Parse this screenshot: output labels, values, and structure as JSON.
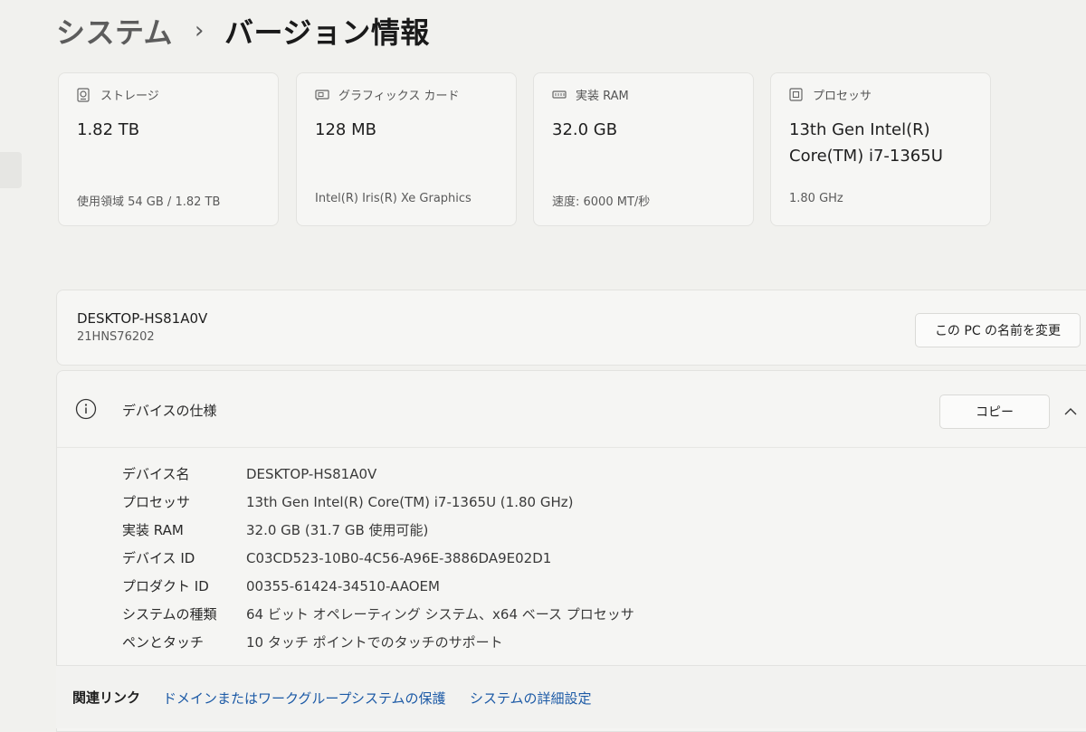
{
  "breadcrumb": {
    "parent": "システム",
    "separator": "›",
    "current": "バージョン情報"
  },
  "cards": [
    {
      "icon": "storage-icon",
      "label": "ストレージ",
      "value": "1.82 TB",
      "detail": "使用領域 54 GB / 1.82 TB"
    },
    {
      "icon": "graphics-card-icon",
      "label": "グラフィックス カード",
      "value": "128 MB",
      "detail": "Intel(R) Iris(R) Xe Graphics"
    },
    {
      "icon": "ram-icon",
      "label": "実装 RAM",
      "value": "32.0 GB",
      "detail": "速度: 6000 MT/秒"
    },
    {
      "icon": "processor-icon",
      "label": "プロセッサ",
      "value": "13th Gen Intel(R) Core(TM) i7-1365U",
      "detail": "1.80 GHz"
    }
  ],
  "device": {
    "name": "DESKTOP-HS81A0V",
    "model": "21HNS76202",
    "rename_label": "この PC の名前を変更"
  },
  "specs": {
    "title": "デバイスの仕様",
    "copy_label": "コピー",
    "rows": [
      {
        "key": "デバイス名",
        "value": "DESKTOP-HS81A0V"
      },
      {
        "key": "プロセッサ",
        "value": "13th Gen Intel(R) Core(TM) i7-1365U (1.80 GHz)"
      },
      {
        "key": "実装 RAM",
        "value": "32.0 GB (31.7 GB 使用可能)"
      },
      {
        "key": "デバイス ID",
        "value": "C03CD523-10B0-4C56-A96E-3886DA9E02D1"
      },
      {
        "key": "プロダクト ID",
        "value": "00355-61424-34510-AAOEM"
      },
      {
        "key": "システムの種類",
        "value": "64 ビット オペレーティング システム、x64 ベース プロセッサ"
      },
      {
        "key": "ペンとタッチ",
        "value": "10 タッチ ポイントでのタッチのサポート"
      }
    ]
  },
  "related": {
    "label": "関連リンク",
    "links": [
      "ドメインまたはワークグループ",
      "システムの保護",
      "システムの詳細設定"
    ]
  },
  "colors": {
    "link": "#1c5aa6",
    "background": "#f1f1ee"
  }
}
